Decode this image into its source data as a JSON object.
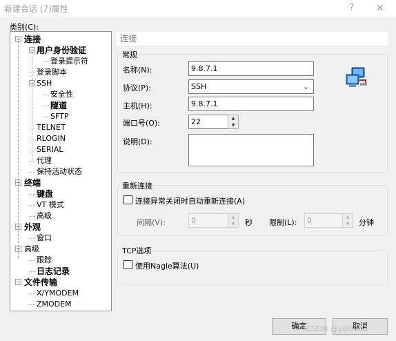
{
  "window": {
    "title": "新建会话 (7)属性",
    "help_glyph": "?",
    "close_glyph": "✕"
  },
  "category_label": "类别(C):",
  "tree": {
    "items": [
      {
        "label": "连接",
        "level": 0,
        "bold": true,
        "expander": "−"
      },
      {
        "label": "用户身份验证",
        "level": 1,
        "bold": true,
        "expander": "−"
      },
      {
        "label": "登录提示符",
        "level": 2
      },
      {
        "label": "登录脚本",
        "level": 1
      },
      {
        "label": "SSH",
        "level": 1,
        "expander": "−"
      },
      {
        "label": "安全性",
        "level": 2
      },
      {
        "label": "隧道",
        "level": 2,
        "bold": true
      },
      {
        "label": "SFTP",
        "level": 2
      },
      {
        "label": "TELNET",
        "level": 1
      },
      {
        "label": "RLOGIN",
        "level": 1
      },
      {
        "label": "SERIAL",
        "level": 1
      },
      {
        "label": "代理",
        "level": 1
      },
      {
        "label": "保持活动状态",
        "level": 1
      },
      {
        "label": "终端",
        "level": 0,
        "bold": true,
        "expander": "−"
      },
      {
        "label": "键盘",
        "level": 1,
        "bold": true
      },
      {
        "label": "VT 模式",
        "level": 1
      },
      {
        "label": "高级",
        "level": 1
      },
      {
        "label": "外观",
        "level": 0,
        "bold": true,
        "expander": "−"
      },
      {
        "label": "窗口",
        "level": 1
      },
      {
        "label": "高级",
        "level": 0,
        "expander": "−"
      },
      {
        "label": "跟踪",
        "level": 1
      },
      {
        "label": "日志记录",
        "level": 1,
        "bold": true
      },
      {
        "label": "文件传输",
        "level": 0,
        "bold": true,
        "expander": "−"
      },
      {
        "label": "X/YMODEM",
        "level": 1
      },
      {
        "label": "ZMODEM",
        "level": 1
      }
    ]
  },
  "panel": {
    "header": "连接",
    "general": {
      "title": "常规",
      "name_label": "名称(N):",
      "name_value": "9.8.7.1",
      "protocol_label": "协议(P):",
      "protocol_value": "SSH",
      "host_label": "主机(H):",
      "host_value": "9.8.7.1",
      "port_label": "端口号(O):",
      "port_value": "22",
      "desc_label": "说明(D):",
      "desc_value": ""
    },
    "reconnect": {
      "title": "重新连接",
      "checkbox_label": "连接异常关闭时自动重新连接(A)",
      "checked": false,
      "interval_label": "间隔(V):",
      "interval_value": "0",
      "interval_unit": "秒",
      "limit_label": "限制(L):",
      "limit_value": "0",
      "limit_unit": "分钟"
    },
    "tcp": {
      "title": "TCP选项",
      "nagle_label": "使用Nagle算法(U)",
      "checked": false
    }
  },
  "buttons": {
    "ok": "确定",
    "cancel": "取消"
  },
  "watermark": "CSDN @yiji0002",
  "icons": {
    "computer": "network-computers-icon"
  },
  "colors": {
    "background": "#f0f0f0",
    "field_border": "#7a7a7a",
    "header_text": "#777777"
  }
}
